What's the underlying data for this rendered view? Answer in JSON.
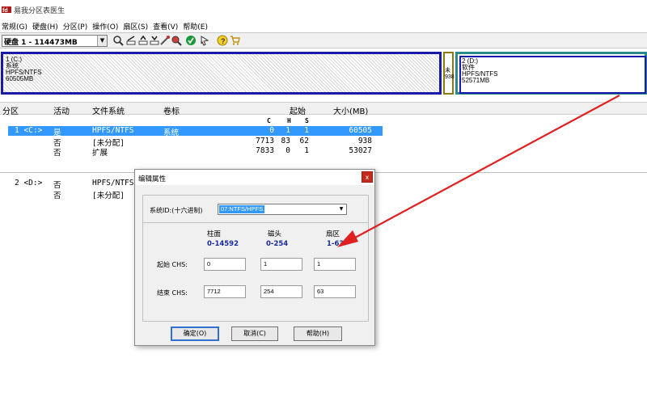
{
  "app": {
    "title": "易我分区表医生",
    "logo_icon": "app-logo-icon"
  },
  "menu": [
    "常规(G)",
    "硬盘(H)",
    "分区(P)",
    "操作(O)",
    "扇区(S)",
    "查看(V)",
    "帮助(E)"
  ],
  "toolbar": {
    "disk_select": "硬盘 1 - 114473MB",
    "buttons": [
      "search-disk-icon",
      "edit-icon",
      "backup-icon",
      "restore-icon",
      "tools-icon",
      "rebuild-icon",
      "check-icon",
      "hint-icon",
      "info-icon",
      "cart-icon"
    ]
  },
  "diskmap": {
    "c": {
      "line1": "1 (C:)",
      "line2": "系统",
      "line3": "HPFS/NTFS",
      "line4": "60505MB"
    },
    "unalloc": {
      "line1": "未",
      "line2": "938"
    },
    "d": {
      "line1": "2 (D:)",
      "line2": "软件",
      "line3": "HPFS/NTFS",
      "line4": "52571MB"
    }
  },
  "table": {
    "headers": {
      "partition": "分区",
      "active": "活动",
      "fs": "文件系统",
      "label": "卷标",
      "start": "起始",
      "size": "大小(MB)"
    },
    "chs": {
      "c": "C",
      "h": "H",
      "s": "S"
    },
    "rows": [
      {
        "part": "1 <C:>",
        "active": "是",
        "fs": "HPFS/NTFS",
        "label": "系统",
        "c": "0",
        "h": "1",
        "s": "1",
        "size": "60505"
      },
      {
        "part": "",
        "active": "否",
        "fs": "[未分配]",
        "label": "",
        "c": "7713",
        "h": "83",
        "s": "62",
        "size": "938"
      },
      {
        "part": "",
        "active": "否",
        "fs": "扩展",
        "label": "",
        "c": "7833",
        "h": "0",
        "s": "1",
        "size": "53027"
      },
      {
        "part": "2 <D:>",
        "active": "否",
        "fs": "HPFS/NTFS",
        "label": "",
        "c": "",
        "h": "",
        "s": "",
        "size": ""
      },
      {
        "part": "",
        "active": "否",
        "fs": "[未分配]",
        "label": "",
        "c": "",
        "h": "",
        "s": "",
        "size": ""
      }
    ]
  },
  "dialog": {
    "title": "编辑属性",
    "close": "x",
    "sysid_label": "系统ID:(十六进制)",
    "sysid_value": "07:NTFS/HPFS",
    "cols": {
      "cyl": "柱面",
      "head": "磁头",
      "sec": "扇区"
    },
    "ranges": {
      "cyl": "0-14592",
      "head": "0-254",
      "sec": "1-63"
    },
    "start_label": "起始 CHS:",
    "end_label": "结束 CHS:",
    "start": {
      "c": "0",
      "h": "1",
      "s": "1"
    },
    "end": {
      "c": "7712",
      "h": "254",
      "s": "63"
    },
    "buttons": {
      "ok": "确定(O)",
      "cancel": "取消(C)",
      "help": "帮助(H)"
    }
  },
  "colors": {
    "selection": "#3399ff",
    "partition_border": "#1a1aa8",
    "extended_border": "#2a8a8a",
    "range_text": "#1a2a9a",
    "arrow": "#e02020"
  }
}
